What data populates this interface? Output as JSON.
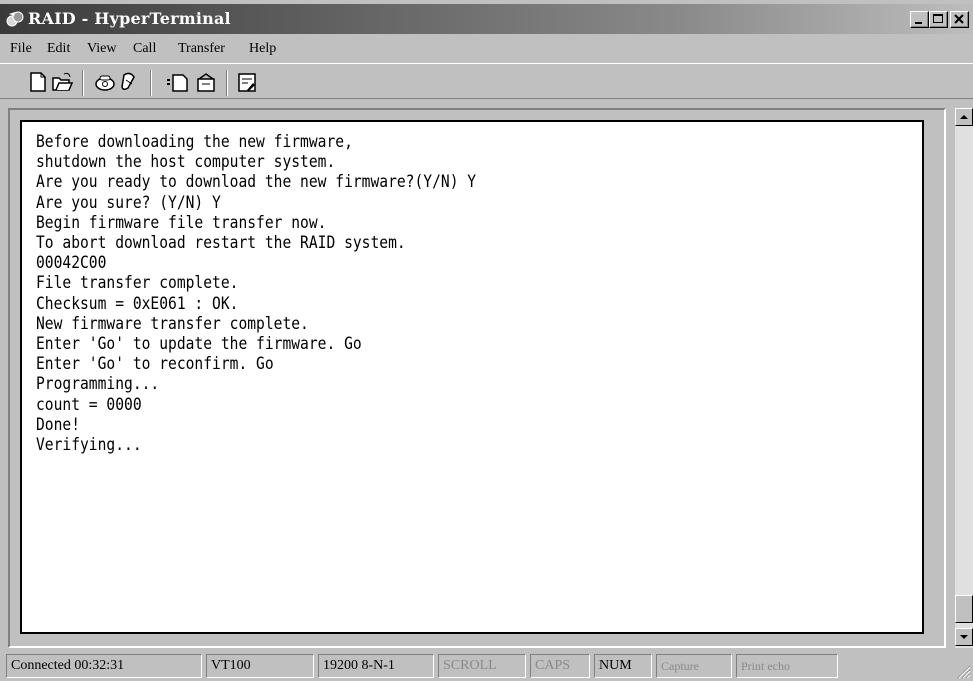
{
  "window": {
    "title": "RAID - HyperTerminal",
    "controls": [
      "minimize",
      "maximize",
      "close"
    ]
  },
  "menu": {
    "items": [
      {
        "label": "File"
      },
      {
        "label": "Edit"
      },
      {
        "label": "View"
      },
      {
        "label": "Call"
      },
      {
        "label": "Transfer"
      },
      {
        "label": "Help"
      }
    ]
  },
  "toolbar": {
    "buttons": [
      "new-icon",
      "open-icon",
      "connect-icon",
      "disconnect-icon",
      "send-icon",
      "receive-icon",
      "properties-icon"
    ]
  },
  "terminal": {
    "lines": [
      "Before downloading the new firmware,",
      "shutdown the host computer system.",
      "Are you ready to download the new firmware?(Y/N) Y",
      "Are you sure? (Y/N) Y",
      "Begin firmware file transfer now.",
      "To abort download restart the RAID system.",
      "00042C00",
      "File transfer complete.",
      "Checksum = 0xE061 : OK.",
      "New firmware transfer complete.",
      "Enter 'Go' to update the firmware. Go",
      "Enter 'Go' to reconfirm. Go",
      "Programming...",
      "count = 0000",
      "Done!",
      "Verifying..."
    ]
  },
  "status": {
    "connected": "Connected 00:32:31",
    "emulation": "VT100",
    "port_settings": "19200 8-N-1",
    "scroll": "SCROLL",
    "caps": "CAPS",
    "num": "NUM",
    "capture": "Capture",
    "print_echo": "Print echo"
  }
}
